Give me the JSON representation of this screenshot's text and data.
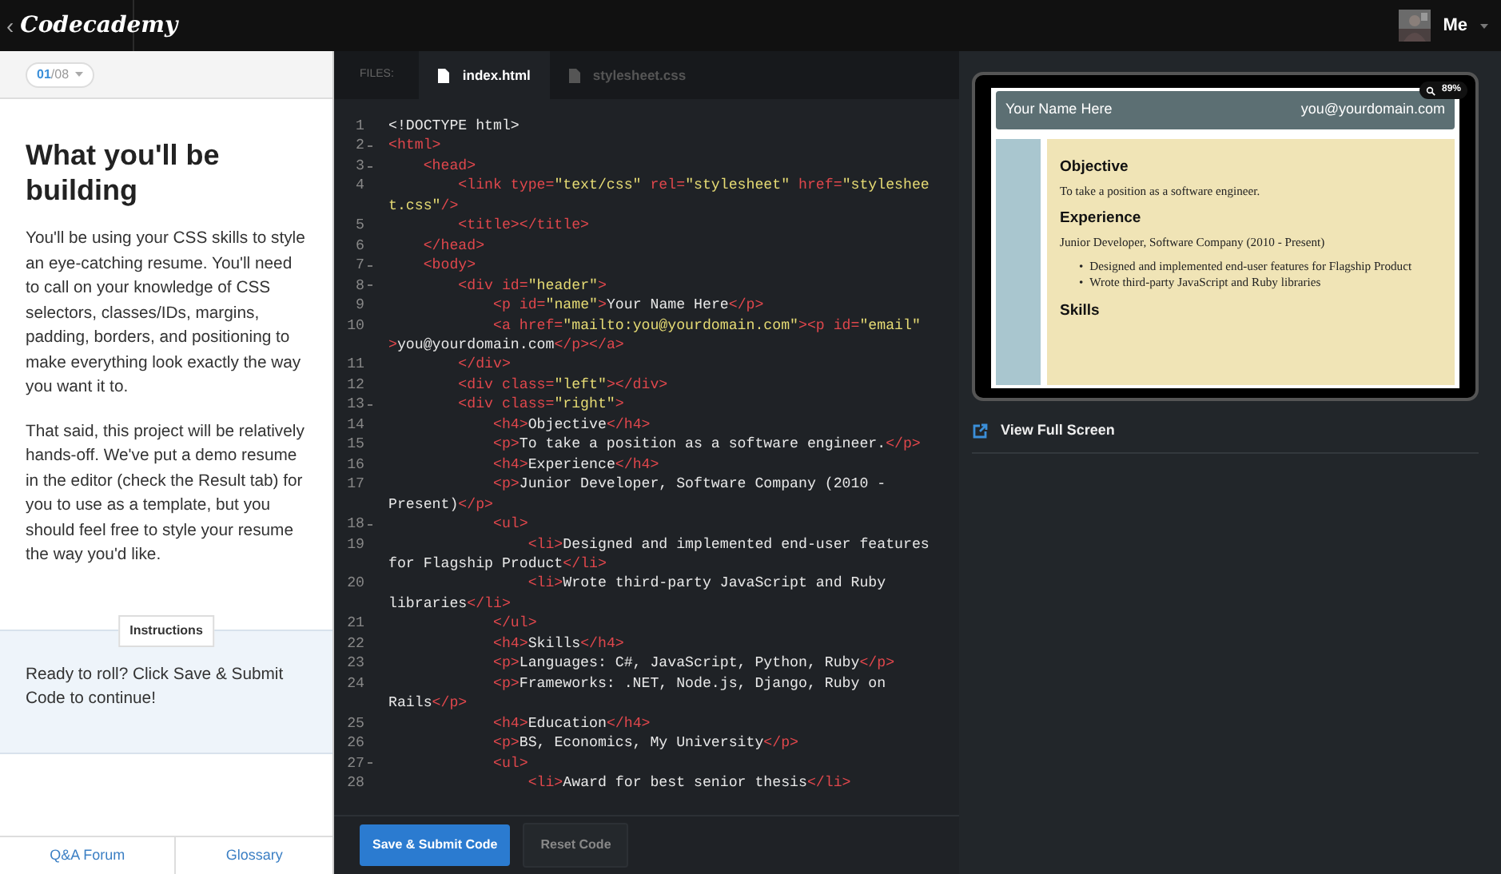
{
  "topbar": {
    "back": "‹",
    "logo": "Codecademy",
    "user": "Me"
  },
  "lesson": {
    "progress_current": "01",
    "progress_total": "/08",
    "title": "What you'll be building",
    "paragraphs": [
      "You'll be using your CSS skills to style an eye-catching resume. You'll need to call on your knowledge of CSS selectors, classes/IDs, margins, padding, borders, and positioning to make everything look exactly the way you want it to.",
      "That said, this project will be relatively hands-off. We've put a demo resume in the editor (check the Result tab) for you to use as a template, but you should feel free to style your resume the way you'd like."
    ],
    "instructions_label": "Instructions",
    "instructions": "Ready to roll? Click Save & Submit Code to continue!",
    "footer_links": [
      "Q&A Forum",
      "Glossary"
    ]
  },
  "editor": {
    "files_label": "FILES:",
    "files": [
      {
        "name": "index.html",
        "selected": true
      },
      {
        "name": "stylesheet.css",
        "selected": false
      }
    ],
    "lines": [
      {
        "number": "1",
        "foldable": false,
        "rows": [
          {
            "tokens": [
              {
                "kind": "text",
                "text": "<!DOCTYPE html>"
              }
            ]
          }
        ]
      },
      {
        "number": "2",
        "foldable": true,
        "rows": [
          {
            "tokens": [
              {
                "kind": "tag",
                "text": "<html>"
              }
            ]
          }
        ]
      },
      {
        "number": "3",
        "foldable": true,
        "rows": [
          {
            "tokens": [
              {
                "kind": "tag",
                "text": "    <head>"
              }
            ]
          }
        ]
      },
      {
        "number": "4",
        "foldable": false,
        "rows": [
          {
            "tokens": [
              {
                "kind": "tag",
                "text": "        <link type="
              },
              {
                "kind": "string",
                "text": "\"text/css\""
              },
              {
                "kind": "tag",
                "text": " rel="
              },
              {
                "kind": "string",
                "text": "\"stylesheet\""
              },
              {
                "kind": "tag",
                "text": " href="
              },
              {
                "kind": "string",
                "text": "\"styleshee"
              }
            ]
          },
          {
            "tokens": [
              {
                "kind": "string",
                "text": "t.css\""
              },
              {
                "kind": "tag",
                "text": "/>"
              }
            ]
          }
        ]
      },
      {
        "number": "5",
        "foldable": false,
        "rows": [
          {
            "tokens": [
              {
                "kind": "tag",
                "text": "        <title></title>"
              }
            ]
          }
        ]
      },
      {
        "number": "6",
        "foldable": false,
        "rows": [
          {
            "tokens": [
              {
                "kind": "tag",
                "text": "    </head>"
              }
            ]
          }
        ]
      },
      {
        "number": "7",
        "foldable": true,
        "rows": [
          {
            "tokens": [
              {
                "kind": "tag",
                "text": "    <body>"
              }
            ]
          }
        ]
      },
      {
        "number": "8",
        "foldable": true,
        "rows": [
          {
            "tokens": [
              {
                "kind": "tag",
                "text": "        <div id="
              },
              {
                "kind": "string",
                "text": "\"header\""
              },
              {
                "kind": "tag",
                "text": ">"
              }
            ]
          }
        ]
      },
      {
        "number": "9",
        "foldable": false,
        "rows": [
          {
            "tokens": [
              {
                "kind": "tag",
                "text": "            <p id="
              },
              {
                "kind": "string",
                "text": "\"name\""
              },
              {
                "kind": "tag",
                "text": ">"
              },
              {
                "kind": "text",
                "text": "Your Name Here"
              },
              {
                "kind": "tag",
                "text": "</p>"
              }
            ]
          }
        ]
      },
      {
        "number": "10",
        "foldable": false,
        "rows": [
          {
            "tokens": [
              {
                "kind": "tag",
                "text": "            <a href="
              },
              {
                "kind": "string",
                "text": "\"mailto:you@yourdomain.com\""
              },
              {
                "kind": "tag",
                "text": "><p id="
              },
              {
                "kind": "string",
                "text": "\"email\""
              }
            ]
          },
          {
            "tokens": [
              {
                "kind": "tag",
                "text": ">"
              },
              {
                "kind": "text",
                "text": "you@yourdomain.com"
              },
              {
                "kind": "tag",
                "text": "</p></a>"
              }
            ]
          }
        ]
      },
      {
        "number": "11",
        "foldable": false,
        "rows": [
          {
            "tokens": [
              {
                "kind": "tag",
                "text": "        </div>"
              }
            ]
          }
        ]
      },
      {
        "number": "12",
        "foldable": false,
        "rows": [
          {
            "tokens": [
              {
                "kind": "tag",
                "text": "        <div class="
              },
              {
                "kind": "string",
                "text": "\"left\""
              },
              {
                "kind": "tag",
                "text": "></div>"
              }
            ]
          }
        ]
      },
      {
        "number": "13",
        "foldable": true,
        "rows": [
          {
            "tokens": [
              {
                "kind": "tag",
                "text": "        <div class="
              },
              {
                "kind": "string",
                "text": "\"right\""
              },
              {
                "kind": "tag",
                "text": ">"
              }
            ]
          }
        ]
      },
      {
        "number": "14",
        "foldable": false,
        "rows": [
          {
            "tokens": [
              {
                "kind": "tag",
                "text": "            <h4>"
              },
              {
                "kind": "text",
                "text": "Objective"
              },
              {
                "kind": "tag",
                "text": "</h4>"
              }
            ]
          }
        ]
      },
      {
        "number": "15",
        "foldable": false,
        "rows": [
          {
            "tokens": [
              {
                "kind": "tag",
                "text": "            <p>"
              },
              {
                "kind": "text",
                "text": "To take a position as a software engineer."
              },
              {
                "kind": "tag",
                "text": "</p>"
              }
            ]
          }
        ]
      },
      {
        "number": "16",
        "foldable": false,
        "rows": [
          {
            "tokens": [
              {
                "kind": "tag",
                "text": "            <h4>"
              },
              {
                "kind": "text",
                "text": "Experience"
              },
              {
                "kind": "tag",
                "text": "</h4>"
              }
            ]
          }
        ]
      },
      {
        "number": "17",
        "foldable": false,
        "rows": [
          {
            "tokens": [
              {
                "kind": "tag",
                "text": "            <p>"
              },
              {
                "kind": "text",
                "text": "Junior Developer, Software Company (2010 -"
              }
            ]
          },
          {
            "tokens": [
              {
                "kind": "text",
                "text": "Present)"
              },
              {
                "kind": "tag",
                "text": "</p>"
              }
            ]
          }
        ]
      },
      {
        "number": "18",
        "foldable": true,
        "rows": [
          {
            "tokens": [
              {
                "kind": "tag",
                "text": "            <ul>"
              }
            ]
          }
        ]
      },
      {
        "number": "19",
        "foldable": false,
        "rows": [
          {
            "tokens": [
              {
                "kind": "tag",
                "text": "                <li>"
              },
              {
                "kind": "text",
                "text": "Designed and implemented end-user features"
              }
            ]
          },
          {
            "tokens": [
              {
                "kind": "text",
                "text": "for Flagship Product"
              },
              {
                "kind": "tag",
                "text": "</li>"
              }
            ]
          }
        ]
      },
      {
        "number": "20",
        "foldable": false,
        "rows": [
          {
            "tokens": [
              {
                "kind": "tag",
                "text": "                <li>"
              },
              {
                "kind": "text",
                "text": "Wrote third-party JavaScript and Ruby"
              }
            ]
          },
          {
            "tokens": [
              {
                "kind": "text",
                "text": "libraries"
              },
              {
                "kind": "tag",
                "text": "</li>"
              }
            ]
          }
        ]
      },
      {
        "number": "21",
        "foldable": false,
        "rows": [
          {
            "tokens": [
              {
                "kind": "tag",
                "text": "            </ul>"
              }
            ]
          }
        ]
      },
      {
        "number": "22",
        "foldable": false,
        "rows": [
          {
            "tokens": [
              {
                "kind": "tag",
                "text": "            <h4>"
              },
              {
                "kind": "text",
                "text": "Skills"
              },
              {
                "kind": "tag",
                "text": "</h4>"
              }
            ]
          }
        ]
      },
      {
        "number": "23",
        "foldable": false,
        "rows": [
          {
            "tokens": [
              {
                "kind": "tag",
                "text": "            <p>"
              },
              {
                "kind": "text",
                "text": "Languages: C#, JavaScript, Python, Ruby"
              },
              {
                "kind": "tag",
                "text": "</p>"
              }
            ]
          }
        ]
      },
      {
        "number": "24",
        "foldable": false,
        "rows": [
          {
            "tokens": [
              {
                "kind": "tag",
                "text": "            <p>"
              },
              {
                "kind": "text",
                "text": "Frameworks: .NET, Node.js, Django, Ruby on"
              }
            ]
          },
          {
            "tokens": [
              {
                "kind": "text",
                "text": "Rails"
              },
              {
                "kind": "tag",
                "text": "</p>"
              }
            ]
          }
        ]
      },
      {
        "number": "25",
        "foldable": false,
        "rows": [
          {
            "tokens": [
              {
                "kind": "tag",
                "text": "            <h4>"
              },
              {
                "kind": "text",
                "text": "Education"
              },
              {
                "kind": "tag",
                "text": "</h4>"
              }
            ]
          }
        ]
      },
      {
        "number": "26",
        "foldable": false,
        "rows": [
          {
            "tokens": [
              {
                "kind": "tag",
                "text": "            <p>"
              },
              {
                "kind": "text",
                "text": "BS, Economics, My University"
              },
              {
                "kind": "tag",
                "text": "</p>"
              }
            ]
          }
        ]
      },
      {
        "number": "27",
        "foldable": true,
        "rows": [
          {
            "tokens": [
              {
                "kind": "tag",
                "text": "            <ul>"
              }
            ]
          }
        ]
      },
      {
        "number": "28",
        "foldable": false,
        "rows": [
          {
            "tokens": [
              {
                "kind": "tag",
                "text": "                <li>"
              },
              {
                "kind": "text",
                "text": "Award for best senior thesis"
              },
              {
                "kind": "tag",
                "text": "</li>"
              }
            ]
          }
        ]
      }
    ],
    "buttons": [
      {
        "label": "Save & Submit Code",
        "kind": "primary"
      },
      {
        "label": "Reset Code",
        "kind": "secondary"
      }
    ]
  },
  "preview": {
    "zoom": "89%",
    "name": "Your Name Here",
    "email": "you@yourdomain.com",
    "blocks": [
      {
        "kind": "heading",
        "text": "Objective"
      },
      {
        "kind": "para",
        "text": "To take a position as a software engineer."
      },
      {
        "kind": "heading",
        "text": "Experience"
      },
      {
        "kind": "para",
        "text": "Junior Developer, Software Company (2010 - Present)"
      },
      {
        "kind": "list",
        "items": [
          {
            "marker": "•",
            "text": "Designed and implemented end-user features for Flagship Product"
          },
          {
            "marker": "•",
            "text": "Wrote third-party JavaScript and Ruby libraries"
          }
        ]
      },
      {
        "kind": "heading",
        "text": "Skills"
      }
    ],
    "full_screen": "View Full Screen"
  }
}
